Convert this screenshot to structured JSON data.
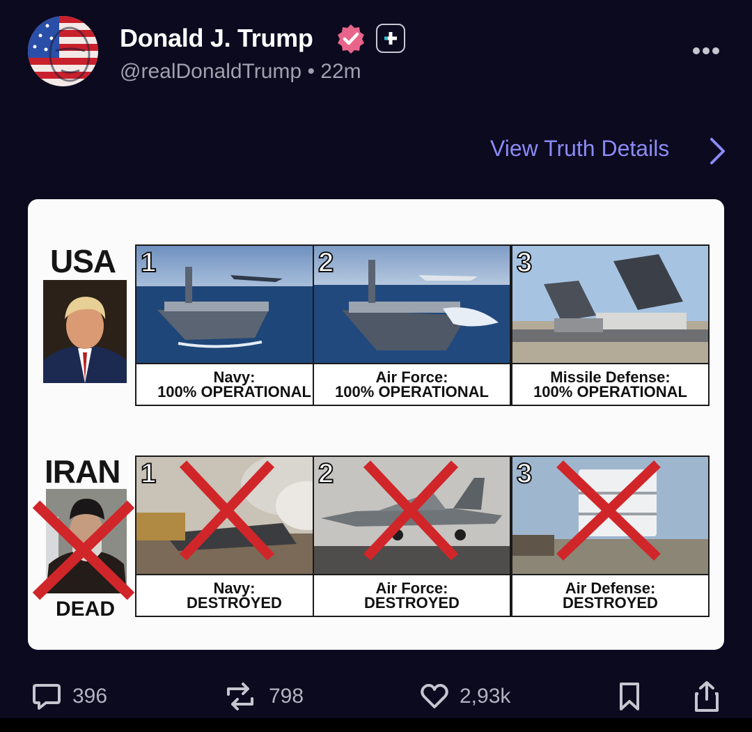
{
  "post": {
    "author_name": "Donald J. Trump",
    "handle_line": "@realDonaldTrump • 22m",
    "view_details_label": "View Truth Details"
  },
  "icons": {
    "verified": "verified-badge-icon",
    "plus": "plus-badge-icon",
    "more": "more-options-icon",
    "chevron": "chevron-right-icon",
    "reply": "reply-icon",
    "retruth": "retruth-icon",
    "like": "heart-icon",
    "bookmark": "bookmark-icon",
    "share": "share-icon"
  },
  "colors": {
    "background": "#0b0a1f",
    "link": "#8c8af5",
    "verified": "#e9648a",
    "cross": "#d0262a"
  },
  "image": {
    "usa": {
      "label": "USA",
      "panels": [
        {
          "number": "1",
          "title": "Navy:",
          "status": "100% OPERATIONAL"
        },
        {
          "number": "2",
          "title": "Air Force:",
          "status": "100% OPERATIONAL"
        },
        {
          "number": "3",
          "title": "Missile Defense:",
          "status": "100% OPERATIONAL"
        }
      ]
    },
    "iran": {
      "label": "IRAN",
      "dead_label": "DEAD",
      "panels": [
        {
          "number": "1",
          "title": "Navy:",
          "status": "DESTROYED"
        },
        {
          "number": "2",
          "title": "Air Force:",
          "status": "DESTROYED"
        },
        {
          "number": "3",
          "title": "Air Defense:",
          "status": "DESTROYED"
        }
      ]
    }
  },
  "actions": {
    "replies": "396",
    "retruths": "798",
    "likes": "2,93k"
  }
}
